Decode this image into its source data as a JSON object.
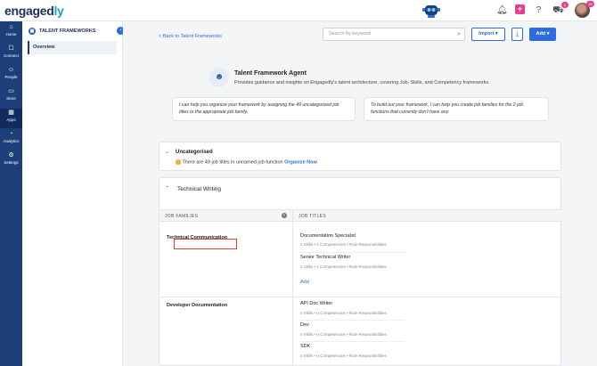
{
  "brand": {
    "logo_text": "engaged",
    "logo_accent": "ly"
  },
  "rail": [
    {
      "label": "Home",
      "icon": "home-icon",
      "glyph": "⌂"
    },
    {
      "label": "Connect",
      "icon": "connect-icon",
      "glyph": "☐"
    },
    {
      "label": "People",
      "icon": "people-icon",
      "glyph": "☺"
    },
    {
      "label": "Store",
      "icon": "store-icon",
      "glyph": "▭"
    },
    {
      "label": "Apps",
      "icon": "apps-icon",
      "glyph": "▦"
    },
    {
      "label": "Analytics",
      "icon": "analytics-icon",
      "glyph": "◔"
    },
    {
      "label": "Settings",
      "icon": "settings-icon",
      "glyph": "⚙"
    }
  ],
  "topbar": {
    "cart_badge": "0",
    "avatar_badge": "19"
  },
  "left_panel": {
    "title": "TALENT FRAMEWORKS",
    "items": [
      "Overview"
    ]
  },
  "toolbar": {
    "back_label": "< Back to Talent Frameworks",
    "search_placeholder": "Search by keyword",
    "import_label": "Import ▾",
    "add_label": "Add ▾"
  },
  "agent": {
    "title": "Talent Framework Agent",
    "description": "Provides guidance and insights on Engagedly's talent architecture, covering Job, Skills, and Competency frameworks.",
    "prompts": [
      "I can help you organize your framework by assigning the 49 uncategorized job titles to the appropriate job family.",
      "To build out your framework, I can help you create job families for the 2 job functions that currently don't have any."
    ]
  },
  "uncategorised": {
    "title": "Uncategorised",
    "text": "There are  49 job titles in unnamed job function",
    "action": "Organize Now"
  },
  "function_section": {
    "title": "Technical Writing",
    "col_families": "JOB FAMILIES",
    "col_titles": "JOB TITLES",
    "add_label": "Add",
    "families": [
      {
        "name": "Technical Communication",
        "jobs": [
          {
            "title": "Documentation Specialist",
            "meta": "2 Skills  •  1 Competencies  •  Role Responsibilities"
          },
          {
            "title": "Senior Technical Writer",
            "meta": "1 Skills  •  1 Competencies  •  Role Responsibilities"
          }
        ]
      },
      {
        "name": "Developer Documentation",
        "jobs": [
          {
            "title": "API Doc Writer",
            "meta": "0 Skills  •  0 Competencies  •  Role Responsibilities"
          },
          {
            "title": "Dev",
            "meta": "0 Skills  •  0 Competencies  •  Role Responsibilities"
          },
          {
            "title": "SDK",
            "meta": "0 Skills  •  0 Competencies  •  Role Responsibilities"
          }
        ]
      }
    ]
  },
  "colors": {
    "rail": "#1c3f7a",
    "accent": "#2d6cdf",
    "pink": "#e83e8c",
    "highlight": "#e03c31"
  }
}
